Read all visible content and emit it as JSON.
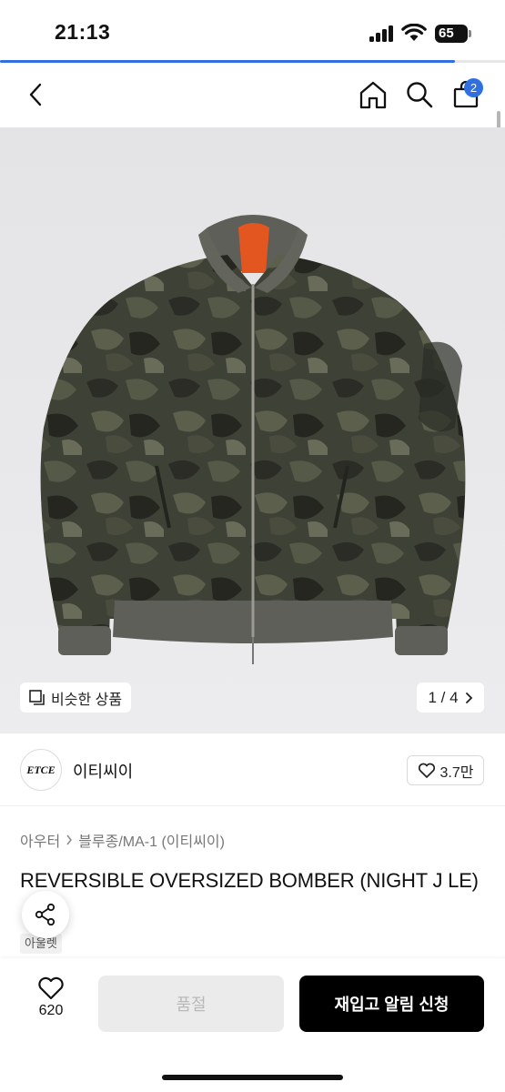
{
  "status": {
    "time": "21:13",
    "battery": "65"
  },
  "load_progress": 0.9,
  "nav": {
    "cart_count": "2"
  },
  "gallery": {
    "similar_label": "비슷한 상품",
    "pager": "1 / 4"
  },
  "brand": {
    "logo_text": "ETCE",
    "name": "이티씨이",
    "likes": "3.7만"
  },
  "breadcrumb": {
    "level1": "아우터",
    "level2": "블루종/MA-1 (이티씨이)"
  },
  "product": {
    "title": "REVERSIBLE OVERSIZED BOMBER (NIGHT J   LE)",
    "tag": "아울렛"
  },
  "bottom": {
    "wish_count": "620",
    "soldout_label": "품절",
    "notify_label": "재입고 알림 신청"
  },
  "colors": {
    "accent": "#2f6fe0",
    "cta": "#000000"
  },
  "icons": [
    "back-icon",
    "home-icon",
    "search-icon",
    "cart-icon",
    "similar-icon",
    "chevron-right-icon",
    "heart-icon",
    "share-icon"
  ]
}
